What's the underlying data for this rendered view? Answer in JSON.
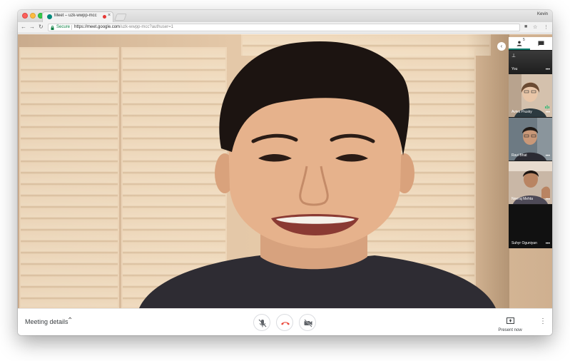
{
  "browser": {
    "tab_title": "Meet – uzk-wwpp-mcc",
    "profile_name": "Kevin",
    "secure_label": "Secure",
    "url_host": "https://meet.google.com",
    "url_path": "/uzk-wwpp-mcc?authuser=1"
  },
  "participants_panel": {
    "people_count": "5",
    "tiles": [
      {
        "name": "You"
      },
      {
        "name": "Aviva Prusky"
      },
      {
        "name": "Ravi Bhat"
      },
      {
        "name": "Neeraj Mehta"
      },
      {
        "name": "Suhyr Oguniyan"
      }
    ]
  },
  "bottom_bar": {
    "meeting_details_label": "Meeting details",
    "present_label": "Present now"
  },
  "colors": {
    "accent": "#00796b",
    "hangup": "#ea4335",
    "secure_green": "#0b8043"
  }
}
